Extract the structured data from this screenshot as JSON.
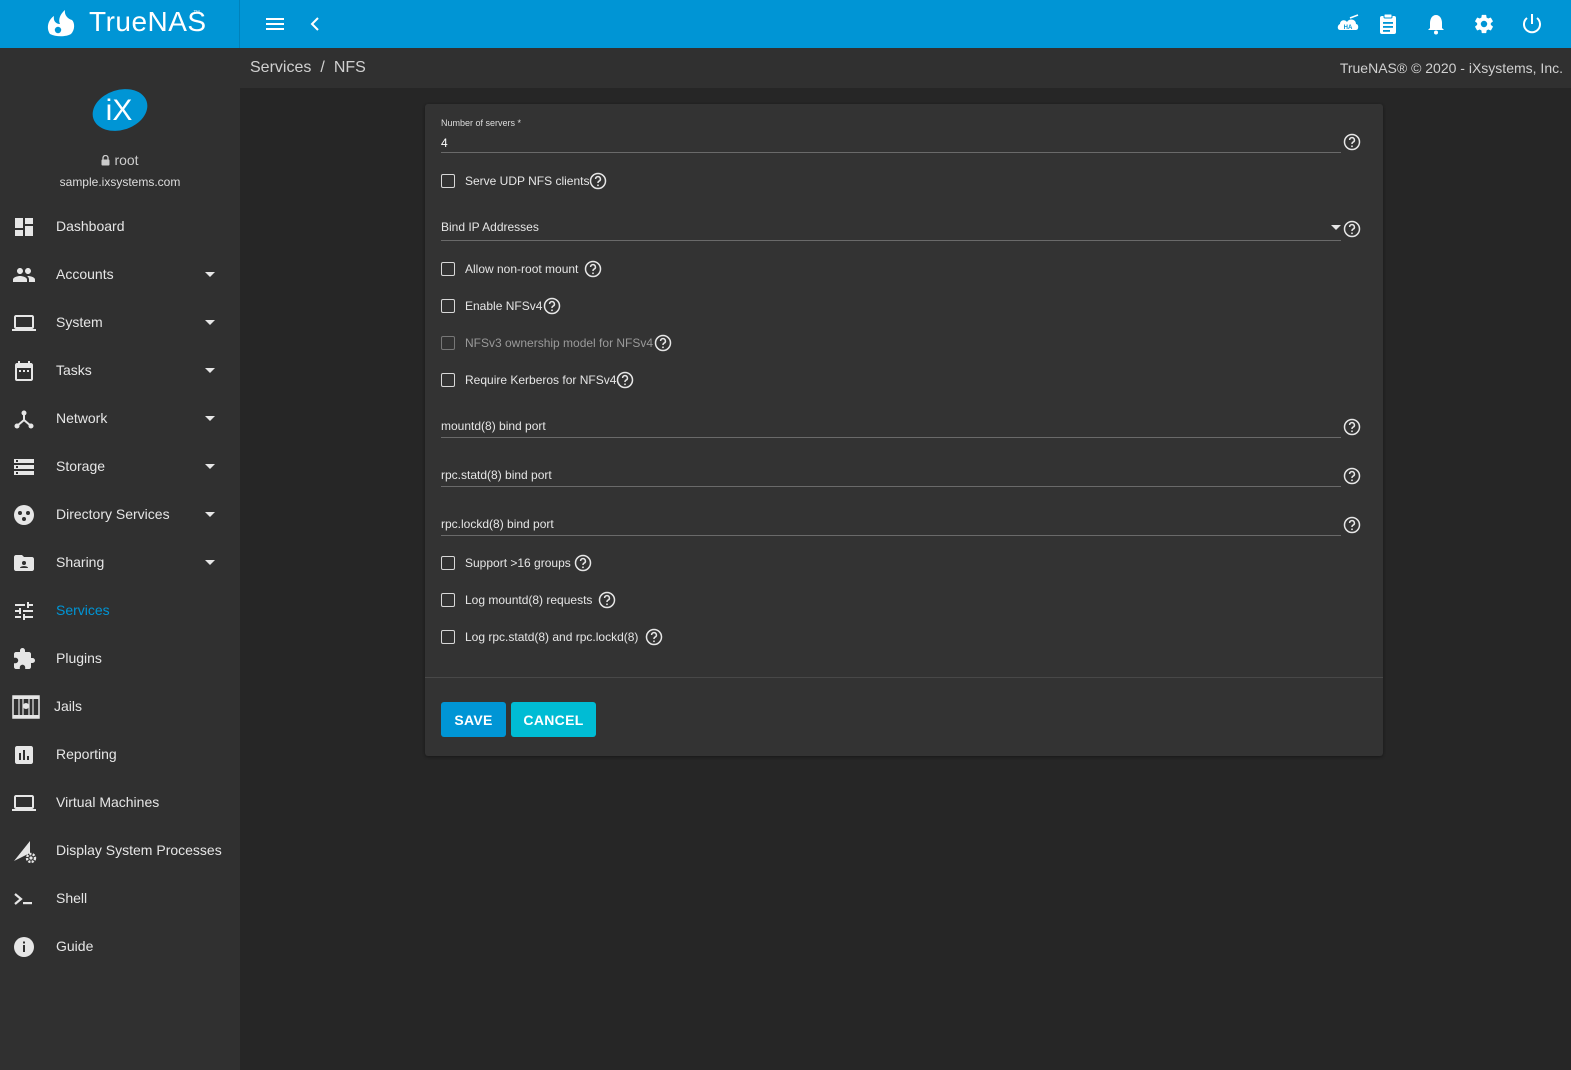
{
  "app": {
    "brand": "TrueNAS",
    "brand_tm": "™",
    "copyright": "TrueNAS® © 2020 - iXsystems, Inc."
  },
  "breadcrumb": [
    "Services",
    "NFS"
  ],
  "breadcrumb_sep": "/",
  "user": {
    "name": "root",
    "host": "sample.ixsystems.com"
  },
  "topbar_icons": [
    "menu-icon",
    "back-chevron-icon",
    "ha-icon",
    "clipboard-icon",
    "bell-icon",
    "gear-icon",
    "power-icon"
  ],
  "sidebar": {
    "items": [
      {
        "label": "Dashboard",
        "icon": "dashboard-icon",
        "expandable": false
      },
      {
        "label": "Accounts",
        "icon": "people-icon",
        "expandable": true
      },
      {
        "label": "System",
        "icon": "laptop-icon",
        "expandable": true
      },
      {
        "label": "Tasks",
        "icon": "calendar-icon",
        "expandable": true
      },
      {
        "label": "Network",
        "icon": "network-icon",
        "expandable": true
      },
      {
        "label": "Storage",
        "icon": "storage-icon",
        "expandable": true
      },
      {
        "label": "Directory Services",
        "icon": "directory-icon",
        "expandable": true
      },
      {
        "label": "Sharing",
        "icon": "folder-share-icon",
        "expandable": true
      },
      {
        "label": "Services",
        "icon": "tune-icon",
        "expandable": false,
        "active": true
      },
      {
        "label": "Plugins",
        "icon": "puzzle-icon",
        "expandable": false
      },
      {
        "label": "Jails",
        "icon": "jail-icon",
        "expandable": false
      },
      {
        "label": "Reporting",
        "icon": "chart-icon",
        "expandable": false
      },
      {
        "label": "Virtual Machines",
        "icon": "laptop-icon",
        "expandable": false
      },
      {
        "label": "Display System Processes",
        "icon": "processes-icon",
        "expandable": false
      },
      {
        "label": "Shell",
        "icon": "shell-icon",
        "expandable": false
      },
      {
        "label": "Guide",
        "icon": "info-icon",
        "expandable": false
      }
    ]
  },
  "form": {
    "num_servers_label": "Number of servers *",
    "num_servers_value": "4",
    "serve_udp_label": "Serve UDP NFS clients",
    "bind_ip_label": "Bind IP Addresses",
    "allow_nonroot_label": "Allow non-root mount",
    "enable_nfsv4_label": "Enable NFSv4",
    "nfsv3_ownership_label": "NFSv3 ownership model for NFSv4",
    "require_kerberos_label": "Require Kerberos for NFSv4",
    "mountd_port_label": "mountd(8) bind port",
    "statd_port_label": "rpc.statd(8) bind port",
    "lockd_port_label": "rpc.lockd(8) bind port",
    "support16_label": "Support >16 groups",
    "log_mountd_label": "Log mountd(8) requests",
    "log_statd_label": "Log rpc.statd(8) and rpc.lockd(8)",
    "save_label": "SAVE",
    "cancel_label": "CANCEL"
  },
  "colors": {
    "accent": "#0095d5",
    "cancel": "#00bcd4",
    "background": "#262626",
    "panel": "#303030"
  }
}
